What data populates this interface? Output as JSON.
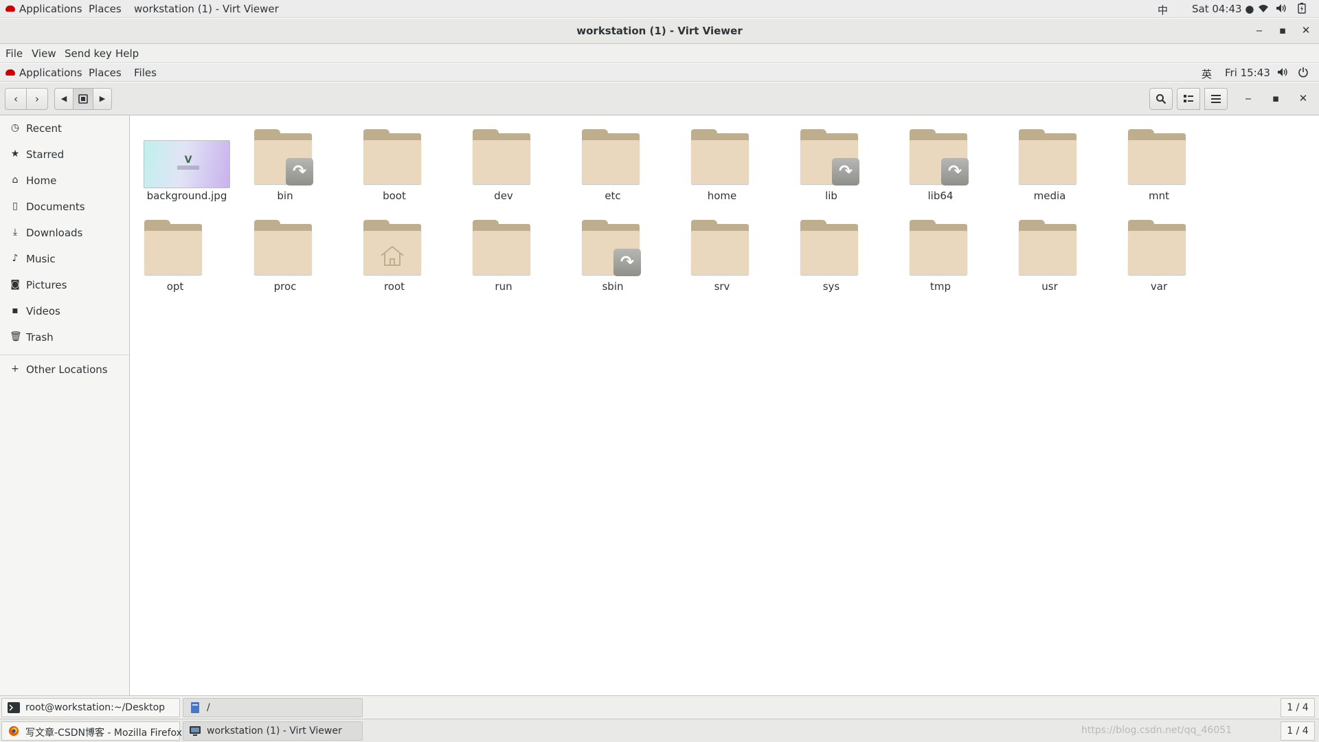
{
  "host_topbar": {
    "applications": "Applications",
    "places": "Places",
    "window_title": "workstation (1) - Virt Viewer",
    "input_method": "中",
    "clock": "Sat 04:43 ●"
  },
  "viewer": {
    "title": "workstation (1) - Virt Viewer",
    "menu": [
      "File",
      "View",
      "Send key",
      "Help"
    ]
  },
  "guest_topbar": {
    "applications": "Applications",
    "places": "Places",
    "files": "Files",
    "input_method": "英",
    "clock": "Fri 15:43"
  },
  "sidebar": {
    "items": [
      {
        "label": "Recent",
        "icon": "clock-icon"
      },
      {
        "label": "Starred",
        "icon": "star-icon"
      },
      {
        "label": "Home",
        "icon": "home-icon"
      },
      {
        "label": "Documents",
        "icon": "document-icon"
      },
      {
        "label": "Downloads",
        "icon": "download-icon"
      },
      {
        "label": "Music",
        "icon": "music-icon"
      },
      {
        "label": "Pictures",
        "icon": "camera-icon"
      },
      {
        "label": "Videos",
        "icon": "video-icon"
      },
      {
        "label": "Trash",
        "icon": "trash-icon"
      }
    ],
    "other_locations": "Other Locations"
  },
  "files": [
    {
      "name": "background.jpg",
      "type": "image"
    },
    {
      "name": "bin",
      "type": "folder-link"
    },
    {
      "name": "boot",
      "type": "folder"
    },
    {
      "name": "dev",
      "type": "folder"
    },
    {
      "name": "etc",
      "type": "folder"
    },
    {
      "name": "home",
      "type": "folder"
    },
    {
      "name": "lib",
      "type": "folder-link"
    },
    {
      "name": "lib64",
      "type": "folder-link"
    },
    {
      "name": "media",
      "type": "folder"
    },
    {
      "name": "mnt",
      "type": "folder"
    },
    {
      "name": "opt",
      "type": "folder"
    },
    {
      "name": "proc",
      "type": "folder"
    },
    {
      "name": "root",
      "type": "folder-home"
    },
    {
      "name": "run",
      "type": "folder"
    },
    {
      "name": "sbin",
      "type": "folder-link"
    },
    {
      "name": "srv",
      "type": "folder"
    },
    {
      "name": "sys",
      "type": "folder"
    },
    {
      "name": "tmp",
      "type": "folder"
    },
    {
      "name": "usr",
      "type": "folder"
    },
    {
      "name": "var",
      "type": "folder"
    }
  ],
  "taskbar_guest": {
    "terminal": "root@workstation:~/Desktop",
    "files_window": "/",
    "pager": "1 / 4"
  },
  "taskbar_host": {
    "firefox": "写文章-CSDN博客 - Mozilla Firefox",
    "viewer": "workstation (1) - Virt Viewer",
    "pager": "1 / 4"
  },
  "watermark": "https://blog.csdn.net/qq_46051"
}
